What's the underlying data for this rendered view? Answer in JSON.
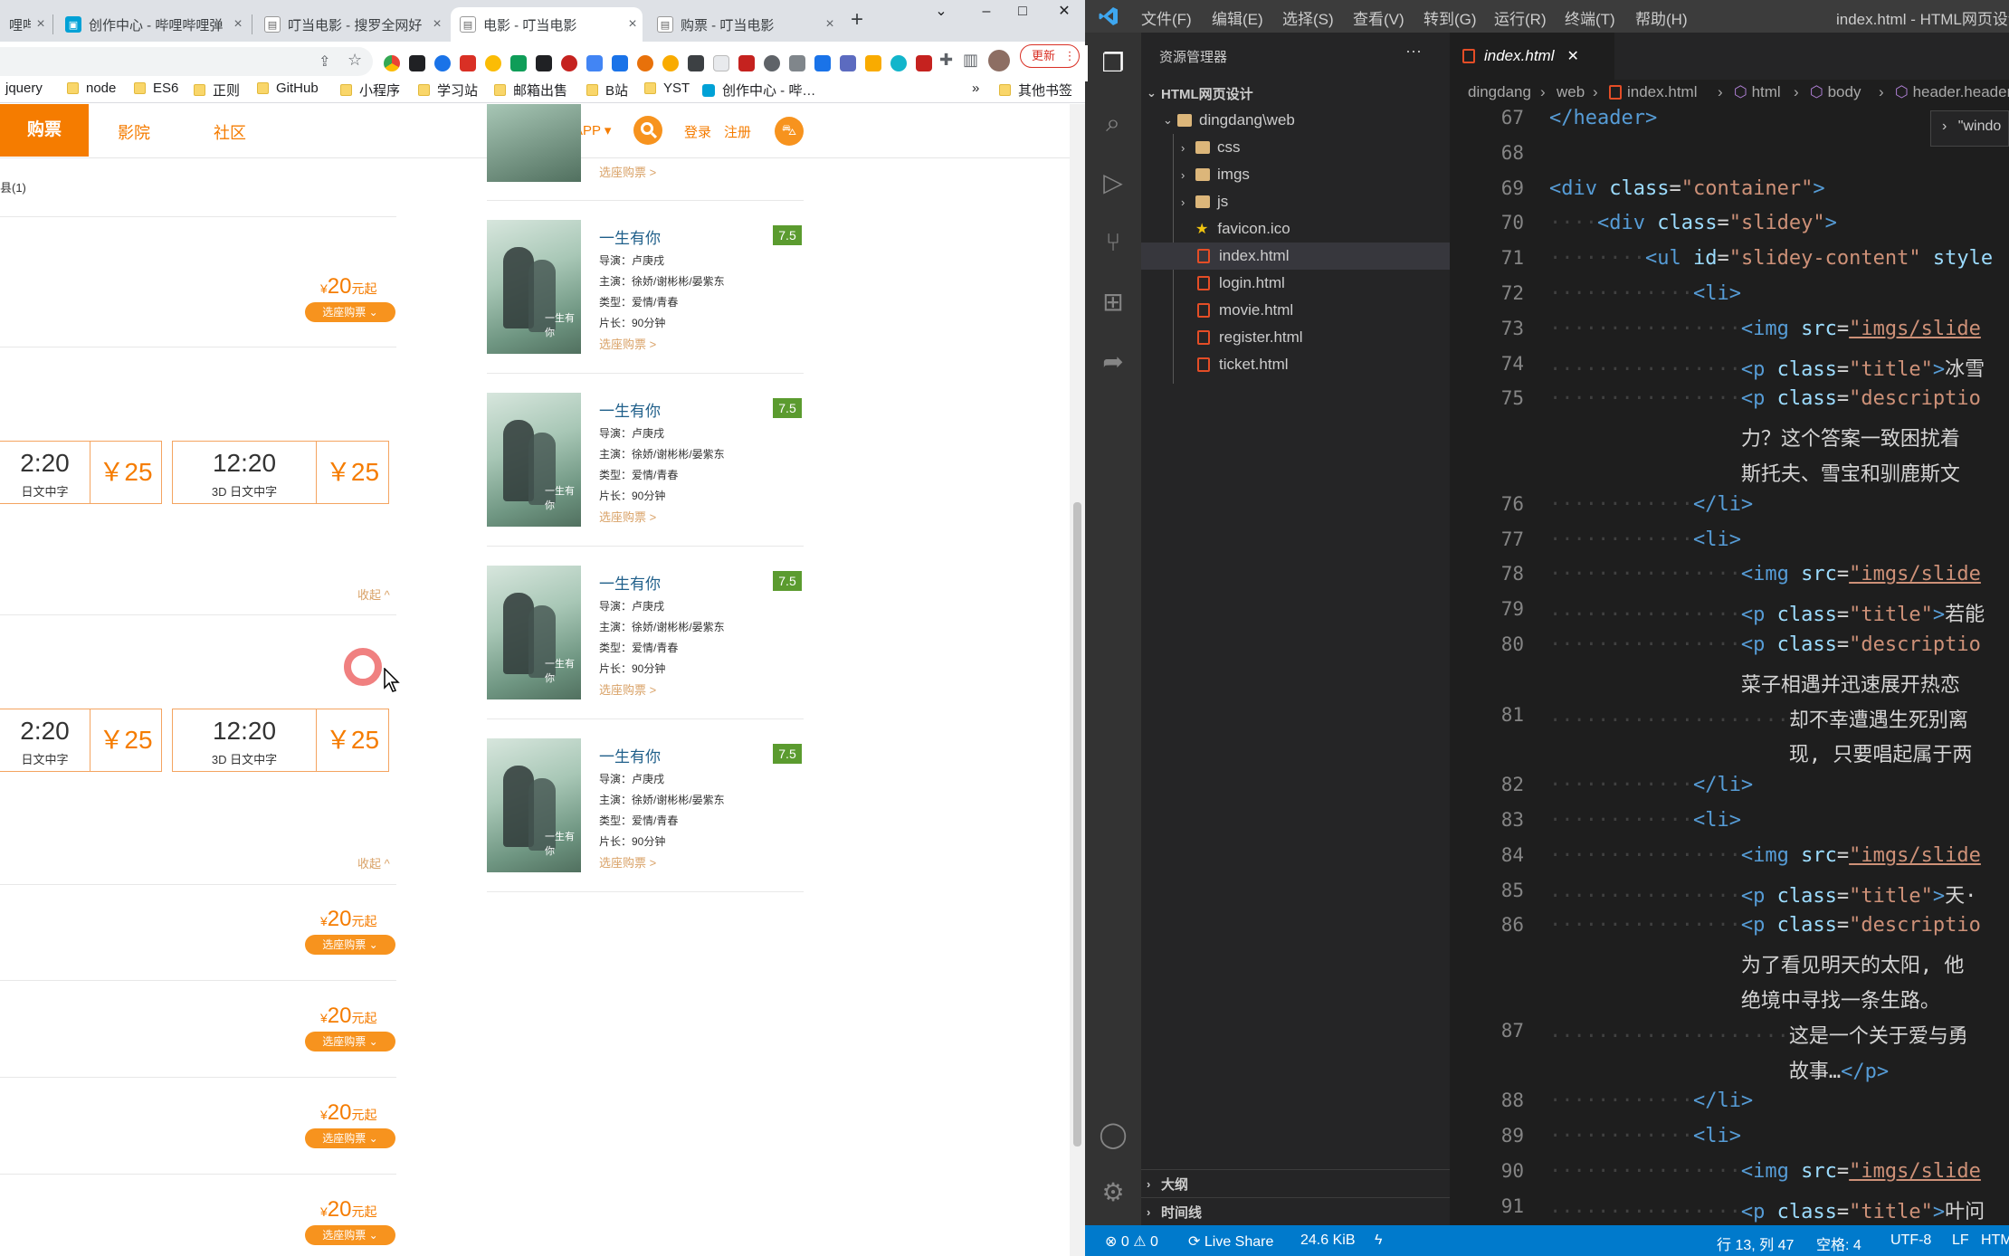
{
  "browser": {
    "tabs": [
      {
        "title": "哩哔哩弹",
        "close": "×"
      },
      {
        "title": "创作中心 - 哔哩哔哩弹",
        "close": "×"
      },
      {
        "title": "叮当电影 - 搜罗全网好",
        "close": "×"
      },
      {
        "title": "电影 - 叮当电影",
        "close": "×",
        "active": true
      },
      {
        "title": "购票 - 叮当电影",
        "close": "×"
      }
    ],
    "new_tab": "+",
    "window_controls": {
      "dropdown": "⌄",
      "minimize": "–",
      "maximize": "□",
      "close": "✕"
    },
    "update_label": "更新",
    "update_menu": "⋮",
    "bookmarks": [
      "jquery",
      "node",
      "ES6",
      "正则",
      "GitHub",
      "小程序",
      "学习站",
      "邮箱出售",
      "B站",
      "YST",
      "创作中心 - 哔…"
    ],
    "bookmarks_more": "»",
    "other_bookmarks": "其他书签"
  },
  "site": {
    "nav": {
      "buy": "购票",
      "cinema": "影院",
      "community": "社区",
      "download": "下载APP",
      "login": "登录",
      "register": "注册"
    },
    "partial_text": "县(1)",
    "price_items": [
      {
        "yen": "¥",
        "amount": "20",
        "suffix": "元起",
        "button": "选座购票 ⌄"
      },
      {
        "yen": "¥",
        "amount": "20",
        "suffix": "元起",
        "button": "选座购票 ⌄"
      },
      {
        "yen": "¥",
        "amount": "20",
        "suffix": "元起",
        "button": "选座购票 ⌄"
      },
      {
        "yen": "¥",
        "amount": "20",
        "suffix": "元起",
        "button": "选座购票 ⌄"
      },
      {
        "yen": "¥",
        "amount": "20",
        "suffix": "元起",
        "button": "选座购票 ⌄"
      }
    ],
    "showtimes": [
      {
        "time_partial": "2:20",
        "desc_partial": "日文中字",
        "price": "￥25",
        "time": "12:20",
        "desc": "3D 日文中字",
        "price2": "￥25"
      },
      {
        "time_partial": "2:20",
        "desc_partial": "日文中字",
        "price": "￥25",
        "time": "12:20",
        "desc": "3D 日文中字",
        "price2": "￥25"
      }
    ],
    "collapse_label": "收起 ^",
    "top_buy_link": "选座购票 >",
    "movies": [
      {
        "title": "一生有你",
        "score": "7.5",
        "director": "导演：卢庚戌",
        "cast": "主演：徐娇/谢彬彬/晏紫东",
        "genre": "类型：爱情/青春",
        "length": "片长：90分钟",
        "buy": "选座购票 >",
        "poster_text": "一生有你"
      },
      {
        "title": "一生有你",
        "score": "7.5",
        "director": "导演：卢庚戌",
        "cast": "主演：徐娇/谢彬彬/晏紫东",
        "genre": "类型：爱情/青春",
        "length": "片长：90分钟",
        "buy": "选座购票 >",
        "poster_text": "一生有你"
      },
      {
        "title": "一生有你",
        "score": "7.5",
        "director": "导演：卢庚戌",
        "cast": "主演：徐娇/谢彬彬/晏紫东",
        "genre": "类型：爱情/青春",
        "length": "片长：90分钟",
        "buy": "选座购票 >",
        "poster_text": "一生有你"
      },
      {
        "title": "一生有你",
        "score": "7.5",
        "director": "导演：卢庚戌",
        "cast": "主演：徐娇/谢彬彬/晏紫东",
        "genre": "类型：爱情/青春",
        "length": "片长：90分钟",
        "buy": "选座购票 >",
        "poster_text": "一生有你"
      }
    ]
  },
  "vscode": {
    "menu": [
      "文件(F)",
      "编辑(E)",
      "选择(S)",
      "查看(V)",
      "转到(G)",
      "运行(R)",
      "终端(T)",
      "帮助(H)"
    ],
    "window_title": "index.html - HTML网页设计",
    "explorer_title": "资源管理器",
    "explorer_more": "···",
    "project": "HTML网页设计",
    "folder_path": "dingdang\\web",
    "tree": [
      {
        "name": "css",
        "type": "folder"
      },
      {
        "name": "imgs",
        "type": "folder"
      },
      {
        "name": "js",
        "type": "folder"
      },
      {
        "name": "favicon.ico",
        "type": "star"
      },
      {
        "name": "index.html",
        "type": "html",
        "selected": true
      },
      {
        "name": "login.html",
        "type": "html"
      },
      {
        "name": "movie.html",
        "type": "html"
      },
      {
        "name": "register.html",
        "type": "html"
      },
      {
        "name": "ticket.html",
        "type": "html"
      }
    ],
    "outline": "大纲",
    "timeline": "时间线",
    "editor_tab": "index.html",
    "editor_tab_close": "✕",
    "breadcrumb": [
      "dingdang",
      "web",
      "index.html",
      "html",
      "body",
      "header.header"
    ],
    "widget_text": "\"windo",
    "status": {
      "errors": "⊗ 0 ⚠ 0",
      "liveshare": "Live Share",
      "size": "24.6 KiB",
      "position": "行 13, 列 47",
      "spaces": "空格: 4",
      "encoding": "UTF-8",
      "eol": "LF",
      "lang": "HTM"
    },
    "lines": [
      {
        "n": "67",
        "indent": "",
        "parts": [
          [
            "tag",
            "</header>"
          ]
        ]
      },
      {
        "n": "68",
        "indent": "",
        "parts": []
      },
      {
        "n": "69",
        "indent": "",
        "parts": [
          [
            "tag",
            "<div "
          ],
          [
            "attr",
            "class"
          ],
          [
            "txt",
            "="
          ],
          [
            "str",
            "\"container\""
          ],
          [
            "tag",
            ">"
          ]
        ]
      },
      {
        "n": "70",
        "indent": "····",
        "parts": [
          [
            "tag",
            "<div "
          ],
          [
            "attr",
            "class"
          ],
          [
            "txt",
            "="
          ],
          [
            "str",
            "\"slidey\""
          ],
          [
            "tag",
            ">"
          ]
        ]
      },
      {
        "n": "71",
        "indent": "········",
        "parts": [
          [
            "tag",
            "<ul "
          ],
          [
            "attr",
            "id"
          ],
          [
            "txt",
            "="
          ],
          [
            "str",
            "\"slidey-content\" "
          ],
          [
            "attr",
            "style"
          ]
        ]
      },
      {
        "n": "72",
        "indent": "············",
        "parts": [
          [
            "tag",
            "<li>"
          ]
        ]
      },
      {
        "n": "73",
        "indent": "················",
        "parts": [
          [
            "tag",
            "<img "
          ],
          [
            "attr",
            "src"
          ],
          [
            "txt",
            "="
          ],
          [
            "strU",
            "\"imgs/slide"
          ]
        ]
      },
      {
        "n": "74",
        "indent": "················",
        "parts": [
          [
            "tag",
            "<p "
          ],
          [
            "attr",
            "class"
          ],
          [
            "txt",
            "="
          ],
          [
            "str",
            "\"title\""
          ],
          [
            "tag",
            ">"
          ],
          [
            "txt",
            "冰雪"
          ]
        ]
      },
      {
        "n": "75",
        "indent": "················",
        "parts": [
          [
            "tag",
            "<p "
          ],
          [
            "attr",
            "class"
          ],
          [
            "txt",
            "="
          ],
          [
            "str",
            "\"descriptio"
          ]
        ]
      },
      {
        "n": "",
        "indent": "                ",
        "parts": [
          [
            "txt",
            "力？这个答案一致困扰着"
          ]
        ]
      },
      {
        "n": "",
        "indent": "                ",
        "parts": [
          [
            "txt",
            "斯托夫、雪宝和驯鹿斯文"
          ]
        ]
      },
      {
        "n": "76",
        "indent": "············",
        "parts": [
          [
            "tag",
            "</li>"
          ]
        ]
      },
      {
        "n": "77",
        "indent": "············",
        "parts": [
          [
            "tag",
            "<li>"
          ]
        ]
      },
      {
        "n": "78",
        "indent": "················",
        "parts": [
          [
            "tag",
            "<img "
          ],
          [
            "attr",
            "src"
          ],
          [
            "txt",
            "="
          ],
          [
            "strU",
            "\"imgs/slide"
          ]
        ]
      },
      {
        "n": "79",
        "indent": "················",
        "parts": [
          [
            "tag",
            "<p "
          ],
          [
            "attr",
            "class"
          ],
          [
            "txt",
            "="
          ],
          [
            "str",
            "\"title\""
          ],
          [
            "tag",
            ">"
          ],
          [
            "txt",
            "若能"
          ]
        ]
      },
      {
        "n": "80",
        "indent": "················",
        "parts": [
          [
            "tag",
            "<p "
          ],
          [
            "attr",
            "class"
          ],
          [
            "txt",
            "="
          ],
          [
            "str",
            "\"descriptio"
          ]
        ]
      },
      {
        "n": "",
        "indent": "                ",
        "parts": [
          [
            "txt",
            "菜子相遇并迅速展开热恋"
          ]
        ]
      },
      {
        "n": "81",
        "indent": "····················",
        "parts": [
          [
            "txt",
            "却不幸遭遇生死别离"
          ]
        ]
      },
      {
        "n": "",
        "indent": "                    ",
        "parts": [
          [
            "txt",
            "现, 只要唱起属于两"
          ]
        ]
      },
      {
        "n": "82",
        "indent": "············",
        "parts": [
          [
            "tag",
            "</li>"
          ]
        ]
      },
      {
        "n": "83",
        "indent": "············",
        "parts": [
          [
            "tag",
            "<li>"
          ]
        ]
      },
      {
        "n": "84",
        "indent": "················",
        "parts": [
          [
            "tag",
            "<img "
          ],
          [
            "attr",
            "src"
          ],
          [
            "txt",
            "="
          ],
          [
            "strU",
            "\"imgs/slide"
          ]
        ]
      },
      {
        "n": "85",
        "indent": "················",
        "parts": [
          [
            "tag",
            "<p "
          ],
          [
            "attr",
            "class"
          ],
          [
            "txt",
            "="
          ],
          [
            "str",
            "\"title\""
          ],
          [
            "tag",
            ">"
          ],
          [
            "txt",
            "天·"
          ]
        ]
      },
      {
        "n": "86",
        "indent": "················",
        "parts": [
          [
            "tag",
            "<p "
          ],
          [
            "attr",
            "class"
          ],
          [
            "txt",
            "="
          ],
          [
            "str",
            "\"descriptio"
          ]
        ]
      },
      {
        "n": "",
        "indent": "                ",
        "parts": [
          [
            "txt",
            "为了看见明天的太阳, 他"
          ]
        ]
      },
      {
        "n": "",
        "indent": "                ",
        "parts": [
          [
            "txt",
            "绝境中寻找一条生路。"
          ]
        ]
      },
      {
        "n": "87",
        "indent": "····················",
        "parts": [
          [
            "txt",
            "这是一个关于爱与勇"
          ]
        ]
      },
      {
        "n": "",
        "indent": "                    ",
        "parts": [
          [
            "txt",
            "故事…"
          ],
          [
            "tag",
            "</p>"
          ]
        ]
      },
      {
        "n": "88",
        "indent": "············",
        "parts": [
          [
            "tag",
            "</li>"
          ]
        ]
      },
      {
        "n": "89",
        "indent": "············",
        "parts": [
          [
            "tag",
            "<li>"
          ]
        ]
      },
      {
        "n": "90",
        "indent": "················",
        "parts": [
          [
            "tag",
            "<img "
          ],
          [
            "attr",
            "src"
          ],
          [
            "txt",
            "="
          ],
          [
            "strU",
            "\"imgs/slide"
          ]
        ]
      },
      {
        "n": "91",
        "indent": "················",
        "parts": [
          [
            "tag",
            "<p "
          ],
          [
            "attr",
            "class"
          ],
          [
            "txt",
            "="
          ],
          [
            "str",
            "\"title\""
          ],
          [
            "tag",
            ">"
          ],
          [
            "txt",
            "叶问"
          ]
        ]
      }
    ]
  }
}
